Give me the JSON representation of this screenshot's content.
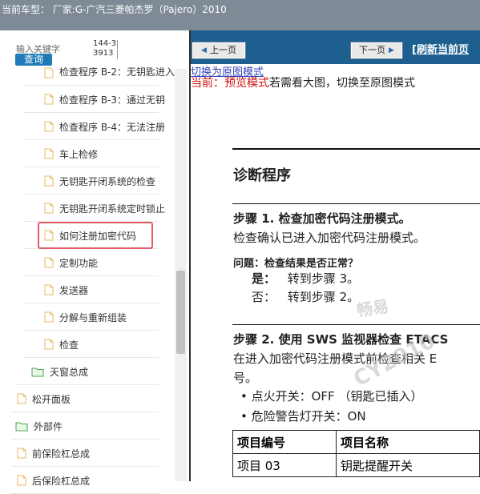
{
  "header": {
    "car_title": "当前车型： 厂家:G-广汽三菱帕杰罗（Pajero）2010"
  },
  "search": {
    "label": "输入关键字",
    "value": "144-33913",
    "button": "查询"
  },
  "tree": [
    {
      "label": "检查程序 B-3：通过无钥",
      "type": "file"
    },
    {
      "label": "检查程序 B-4：无法注册",
      "type": "file"
    },
    {
      "label": "车上检修",
      "type": "file"
    },
    {
      "label": "无钥匙开闭系统的检查",
      "type": "file"
    },
    {
      "label": "无钥匙开闭系统定时锁止",
      "type": "file"
    },
    {
      "label": "如何注册加密代码",
      "type": "file",
      "selected": true
    },
    {
      "label": "定制功能",
      "type": "file"
    },
    {
      "label": "发送器",
      "type": "file"
    },
    {
      "label": "分解与重新组装",
      "type": "file"
    },
    {
      "label": "检查",
      "type": "file"
    },
    {
      "label": "天窗总成",
      "type": "folder"
    },
    {
      "label": "松开面板",
      "type": "file"
    },
    {
      "label": "外部件",
      "type": "folder"
    },
    {
      "label": "前保险杠总成",
      "type": "file"
    },
    {
      "label": "后保险杠总成",
      "type": "file"
    }
  ],
  "tree_partial_top": "检查程序 B-2：无钥匙进入",
  "nav": {
    "prev": "上一页",
    "next": "下一页",
    "refresh": "[刷新当前页"
  },
  "mode": {
    "switch_link": "切换为原图模式",
    "current_label": "当前：",
    "current_mode": "预览模式",
    "hint": "若需看大图，切换至原图模式"
  },
  "doc": {
    "title": "诊断程序",
    "step1": "步骤 1. 检查加密代码注册模式。",
    "step1_desc": "检查确认已进入加密代码注册模式。",
    "question": "问题：检查结果是否正常？",
    "yes_label": "是：",
    "yes_text": "转到步骤 3。",
    "no_label": "否：",
    "no_text": "转到步骤 2。",
    "step2": "步骤 2. 使用 SWS 监视器检查 ETACS",
    "step2_desc": "在进入加密代码注册模式前检查相关 E",
    "step2_desc2": "号。",
    "bullets": [
      "点火开关：OFF （钥匙已插入）",
      "危险警告灯开关：ON"
    ],
    "table": {
      "headers": [
        "项目编号",
        "项目名称"
      ],
      "rows": [
        [
          "项目 03",
          "钥匙提醒开关"
        ]
      ]
    }
  },
  "watermarks": [
    "畅易",
    "CY2010"
  ],
  "colors": {
    "nav_bg": "#1d5f8f",
    "selected_border": "#e35a68",
    "search_btn": "#1f7ab9",
    "mode_red": "#d01010"
  }
}
